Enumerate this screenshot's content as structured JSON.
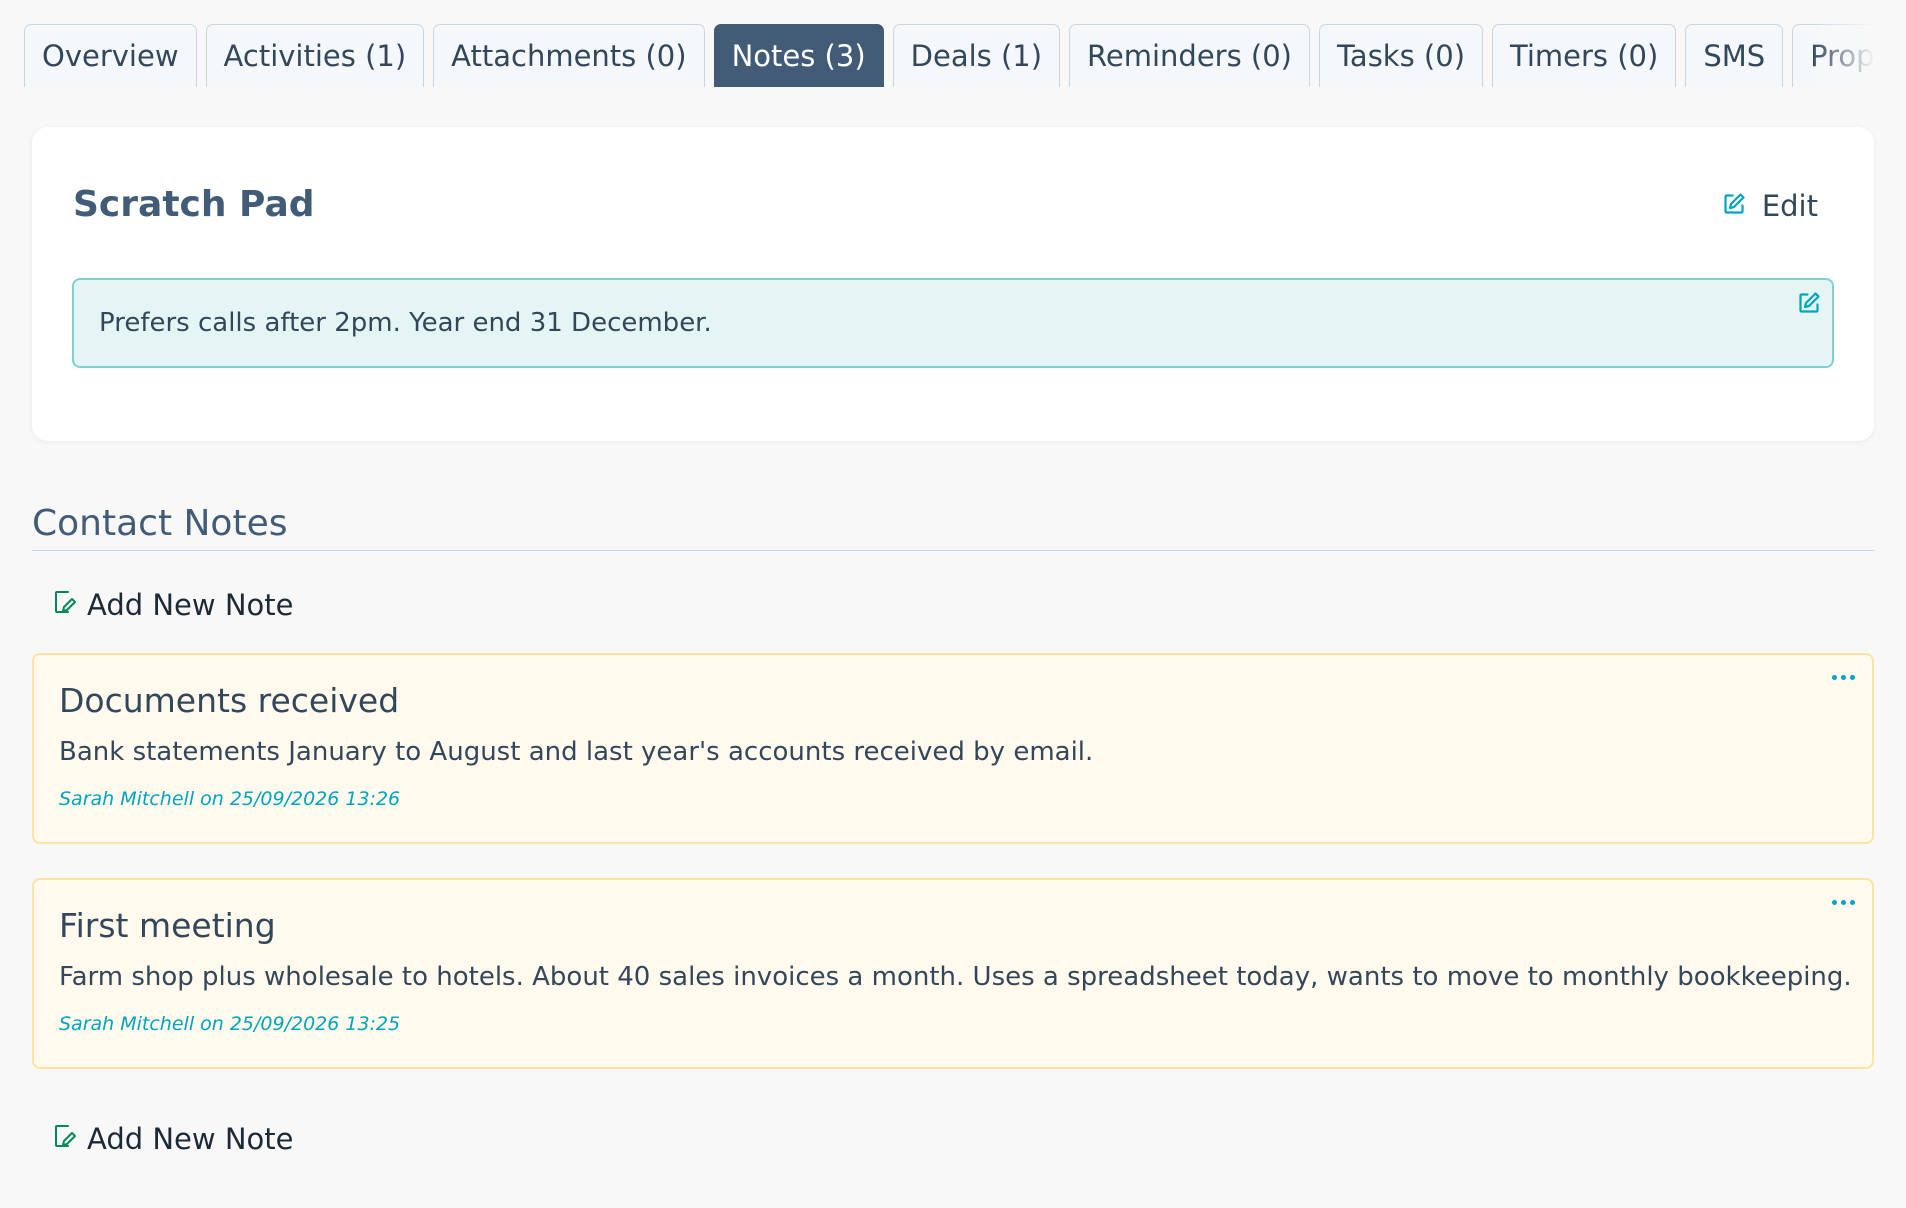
{
  "tabs": [
    {
      "label": "Overview"
    },
    {
      "label": "Activities (1)"
    },
    {
      "label": "Attachments (0)"
    },
    {
      "label": "Notes (3)"
    },
    {
      "label": "Deals (1)"
    },
    {
      "label": "Reminders (0)"
    },
    {
      "label": "Tasks (0)"
    },
    {
      "label": "Timers (0)"
    },
    {
      "label": "SMS"
    },
    {
      "label": "Proposals"
    }
  ],
  "active_tab": "Notes (3)",
  "scratch_pad": {
    "title": "Scratch Pad",
    "edit_label": "Edit",
    "text": "Prefers calls after 2pm. Year end 31 December."
  },
  "contact_notes": {
    "heading": "Contact Notes",
    "add_label": "Add New Note",
    "notes": [
      {
        "title": "Documents received",
        "body": "Bank statements January to August and last year's accounts received by email.",
        "meta": "Sarah Mitchell on 25/09/2026 13:26"
      },
      {
        "title": "First meeting",
        "body": "Farm shop plus wholesale to hotels. About 40 sales invoices a month. Uses a spreadsheet today, wants to move to monthly bookkeeping.",
        "meta": "Sarah Mitchell on 25/09/2026 13:25"
      }
    ]
  },
  "icons": {
    "edit": "edit-square-icon",
    "add_note": "note-edit-icon",
    "note_menu": "more-horizontal-icon"
  },
  "colors": {
    "active_tab": "#425b76",
    "accent": "#00a4bd",
    "scratch_bg": "#e5f5f3",
    "note_bg": "#fffaed",
    "add_icon": "#00875a"
  }
}
